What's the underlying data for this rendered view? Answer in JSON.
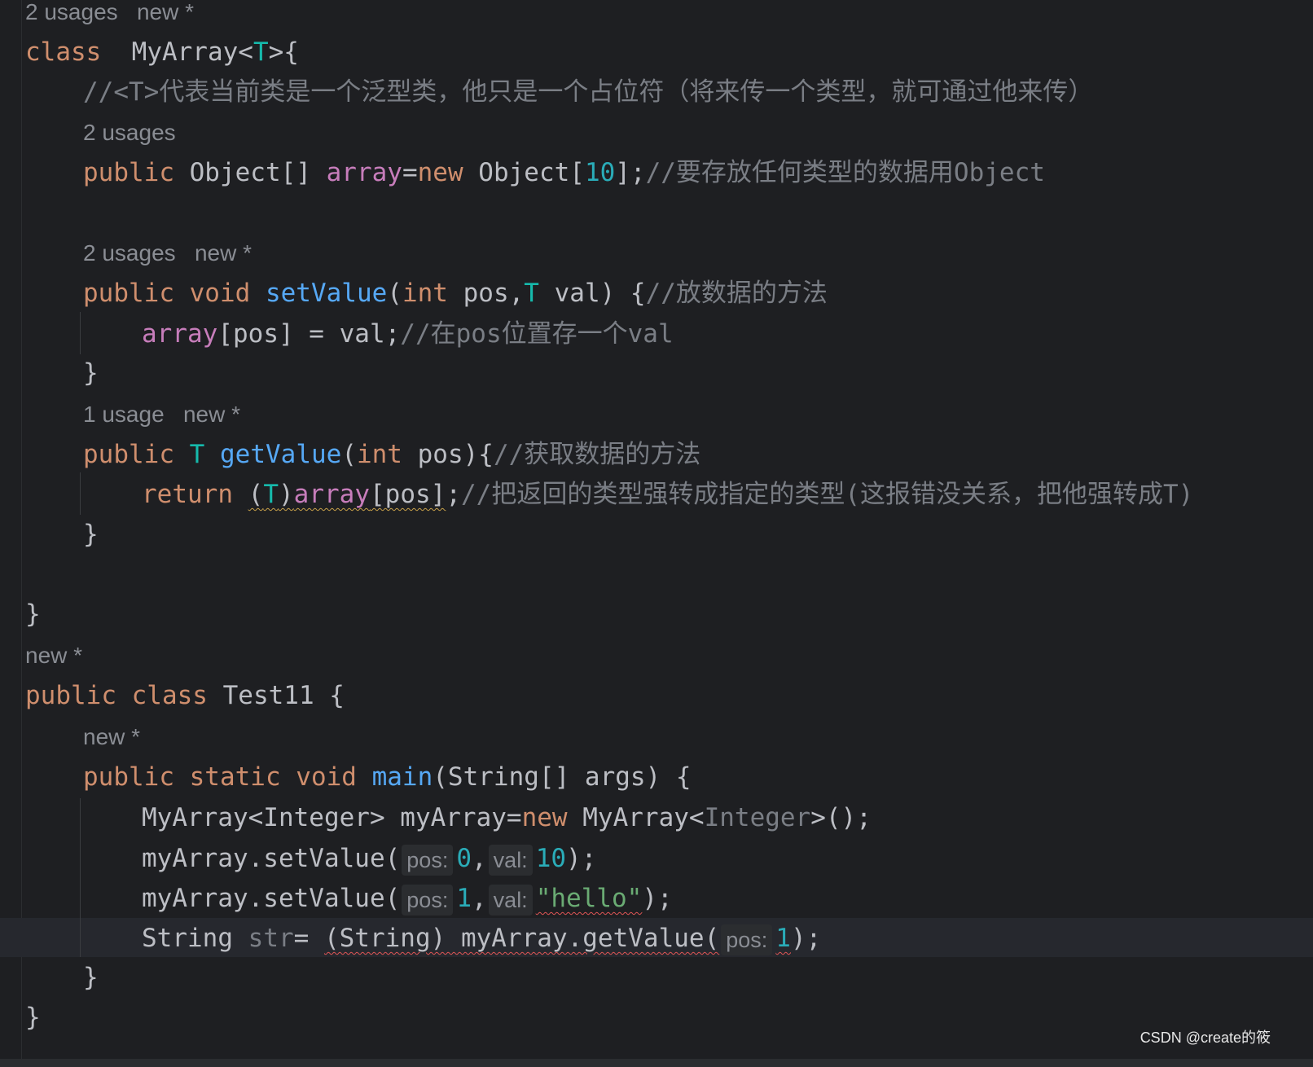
{
  "hints": {
    "h1": "2 usages   new *",
    "h2": "2 usages",
    "h3": "2 usages   new *",
    "h4": "1 usage   new *",
    "h5": "new *",
    "h6": "new *"
  },
  "code": {
    "l1_kw": "class",
    "l1_name": "  MyArray<",
    "l1_t": "T",
    "l1_end": ">{",
    "l2_comment": "//<T>代表当前类是一个泛型类，他只是一个占位符（将来传一个类型，就可通过他来传）",
    "l3_kw": "public",
    "l3_type": " Object[] ",
    "l3_field": "array",
    "l3_eq": "=",
    "l3_new": "new",
    "l3_obj": " Object[",
    "l3_num": "10",
    "l3_close": "];",
    "l3_comment": "//要存放任何类型的数据用Object",
    "l4_kw": "public void ",
    "l4_fn": "setValue",
    "l4_p1": "(",
    "l4_int": "int",
    "l4_p2": " pos,",
    "l4_t": "T",
    "l4_p3": " val) {",
    "l4_comment": "//放数据的方法",
    "l5_field": "array",
    "l5_rest": "[pos] = val;",
    "l5_comment": "//在pos位置存一个val",
    "brace": "}",
    "l6_kw": "public ",
    "l6_t": "T",
    "l6_sp": " ",
    "l6_fn": "getValue",
    "l6_p1": "(",
    "l6_int": "int",
    "l6_p2": " pos){",
    "l6_comment": "//获取数据的方法",
    "l7_kw": "return ",
    "l7_p1": "(",
    "l7_t": "T",
    "l7_p2": ")",
    "l7_field": "array",
    "l7_p3": "[pos]",
    "l7_semi": ";",
    "l7_comment": "//把返回的类型强转成指定的类型(这报错没关系，把他强转成T)",
    "l8_kw": "public class",
    "l8_rest": " Test11 {",
    "l9_kw": "public static void ",
    "l9_fn": "main",
    "l9_rest": "(String[] args) {",
    "l10_a": "MyArray<Integer> myArray=",
    "l10_new": "new",
    "l10_b": " MyArray<",
    "l10_int": "Integer",
    "l10_c": ">();",
    "l11_a": "myArray.setValue(",
    "l11_h1": "pos:",
    "l11_n1": "0",
    "l11_comma": ",",
    "l11_h2": "val:",
    "l11_n2": "10",
    "l11_end": ");",
    "l12_a": "myArray.setValue(",
    "l12_h1": "pos:",
    "l12_n1": "1",
    "l12_comma": ",",
    "l12_h2": "val:",
    "l12_str": "\"hello\"",
    "l12_end": ");",
    "l13_a": "String ",
    "l13_var": "str",
    "l13_eq": "= ",
    "l13_cast": "(String) myArray.getValue(",
    "l13_h1": "pos:",
    "l13_n1": "1",
    "l13_end": ");"
  },
  "watermark": "CSDN @create的筱"
}
